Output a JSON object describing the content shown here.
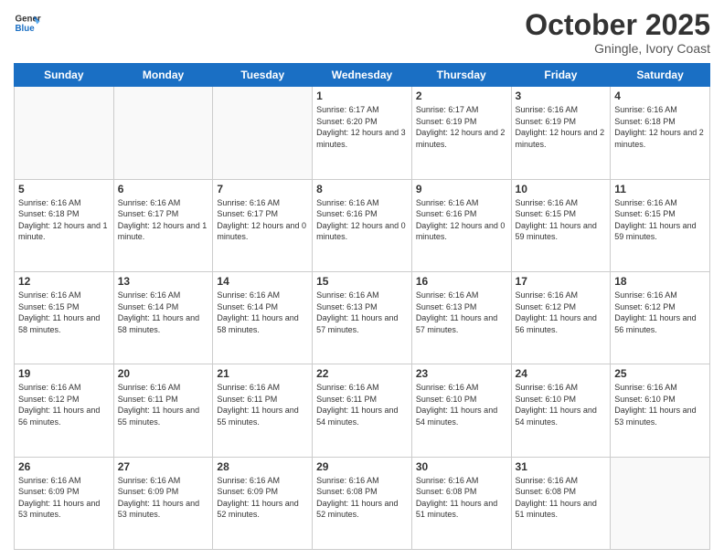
{
  "header": {
    "logo_line1": "General",
    "logo_line2": "Blue",
    "month": "October 2025",
    "location": "Gningle, Ivory Coast"
  },
  "weekdays": [
    "Sunday",
    "Monday",
    "Tuesday",
    "Wednesday",
    "Thursday",
    "Friday",
    "Saturday"
  ],
  "weeks": [
    [
      {
        "day": "",
        "info": ""
      },
      {
        "day": "",
        "info": ""
      },
      {
        "day": "",
        "info": ""
      },
      {
        "day": "1",
        "info": "Sunrise: 6:17 AM\nSunset: 6:20 PM\nDaylight: 12 hours and 3 minutes."
      },
      {
        "day": "2",
        "info": "Sunrise: 6:17 AM\nSunset: 6:19 PM\nDaylight: 12 hours and 2 minutes."
      },
      {
        "day": "3",
        "info": "Sunrise: 6:16 AM\nSunset: 6:19 PM\nDaylight: 12 hours and 2 minutes."
      },
      {
        "day": "4",
        "info": "Sunrise: 6:16 AM\nSunset: 6:18 PM\nDaylight: 12 hours and 2 minutes."
      }
    ],
    [
      {
        "day": "5",
        "info": "Sunrise: 6:16 AM\nSunset: 6:18 PM\nDaylight: 12 hours and 1 minute."
      },
      {
        "day": "6",
        "info": "Sunrise: 6:16 AM\nSunset: 6:17 PM\nDaylight: 12 hours and 1 minute."
      },
      {
        "day": "7",
        "info": "Sunrise: 6:16 AM\nSunset: 6:17 PM\nDaylight: 12 hours and 0 minutes."
      },
      {
        "day": "8",
        "info": "Sunrise: 6:16 AM\nSunset: 6:16 PM\nDaylight: 12 hours and 0 minutes."
      },
      {
        "day": "9",
        "info": "Sunrise: 6:16 AM\nSunset: 6:16 PM\nDaylight: 12 hours and 0 minutes."
      },
      {
        "day": "10",
        "info": "Sunrise: 6:16 AM\nSunset: 6:15 PM\nDaylight: 11 hours and 59 minutes."
      },
      {
        "day": "11",
        "info": "Sunrise: 6:16 AM\nSunset: 6:15 PM\nDaylight: 11 hours and 59 minutes."
      }
    ],
    [
      {
        "day": "12",
        "info": "Sunrise: 6:16 AM\nSunset: 6:15 PM\nDaylight: 11 hours and 58 minutes."
      },
      {
        "day": "13",
        "info": "Sunrise: 6:16 AM\nSunset: 6:14 PM\nDaylight: 11 hours and 58 minutes."
      },
      {
        "day": "14",
        "info": "Sunrise: 6:16 AM\nSunset: 6:14 PM\nDaylight: 11 hours and 58 minutes."
      },
      {
        "day": "15",
        "info": "Sunrise: 6:16 AM\nSunset: 6:13 PM\nDaylight: 11 hours and 57 minutes."
      },
      {
        "day": "16",
        "info": "Sunrise: 6:16 AM\nSunset: 6:13 PM\nDaylight: 11 hours and 57 minutes."
      },
      {
        "day": "17",
        "info": "Sunrise: 6:16 AM\nSunset: 6:12 PM\nDaylight: 11 hours and 56 minutes."
      },
      {
        "day": "18",
        "info": "Sunrise: 6:16 AM\nSunset: 6:12 PM\nDaylight: 11 hours and 56 minutes."
      }
    ],
    [
      {
        "day": "19",
        "info": "Sunrise: 6:16 AM\nSunset: 6:12 PM\nDaylight: 11 hours and 56 minutes."
      },
      {
        "day": "20",
        "info": "Sunrise: 6:16 AM\nSunset: 6:11 PM\nDaylight: 11 hours and 55 minutes."
      },
      {
        "day": "21",
        "info": "Sunrise: 6:16 AM\nSunset: 6:11 PM\nDaylight: 11 hours and 55 minutes."
      },
      {
        "day": "22",
        "info": "Sunrise: 6:16 AM\nSunset: 6:11 PM\nDaylight: 11 hours and 54 minutes."
      },
      {
        "day": "23",
        "info": "Sunrise: 6:16 AM\nSunset: 6:10 PM\nDaylight: 11 hours and 54 minutes."
      },
      {
        "day": "24",
        "info": "Sunrise: 6:16 AM\nSunset: 6:10 PM\nDaylight: 11 hours and 54 minutes."
      },
      {
        "day": "25",
        "info": "Sunrise: 6:16 AM\nSunset: 6:10 PM\nDaylight: 11 hours and 53 minutes."
      }
    ],
    [
      {
        "day": "26",
        "info": "Sunrise: 6:16 AM\nSunset: 6:09 PM\nDaylight: 11 hours and 53 minutes."
      },
      {
        "day": "27",
        "info": "Sunrise: 6:16 AM\nSunset: 6:09 PM\nDaylight: 11 hours and 53 minutes."
      },
      {
        "day": "28",
        "info": "Sunrise: 6:16 AM\nSunset: 6:09 PM\nDaylight: 11 hours and 52 minutes."
      },
      {
        "day": "29",
        "info": "Sunrise: 6:16 AM\nSunset: 6:08 PM\nDaylight: 11 hours and 52 minutes."
      },
      {
        "day": "30",
        "info": "Sunrise: 6:16 AM\nSunset: 6:08 PM\nDaylight: 11 hours and 51 minutes."
      },
      {
        "day": "31",
        "info": "Sunrise: 6:16 AM\nSunset: 6:08 PM\nDaylight: 11 hours and 51 minutes."
      },
      {
        "day": "",
        "info": ""
      }
    ]
  ]
}
